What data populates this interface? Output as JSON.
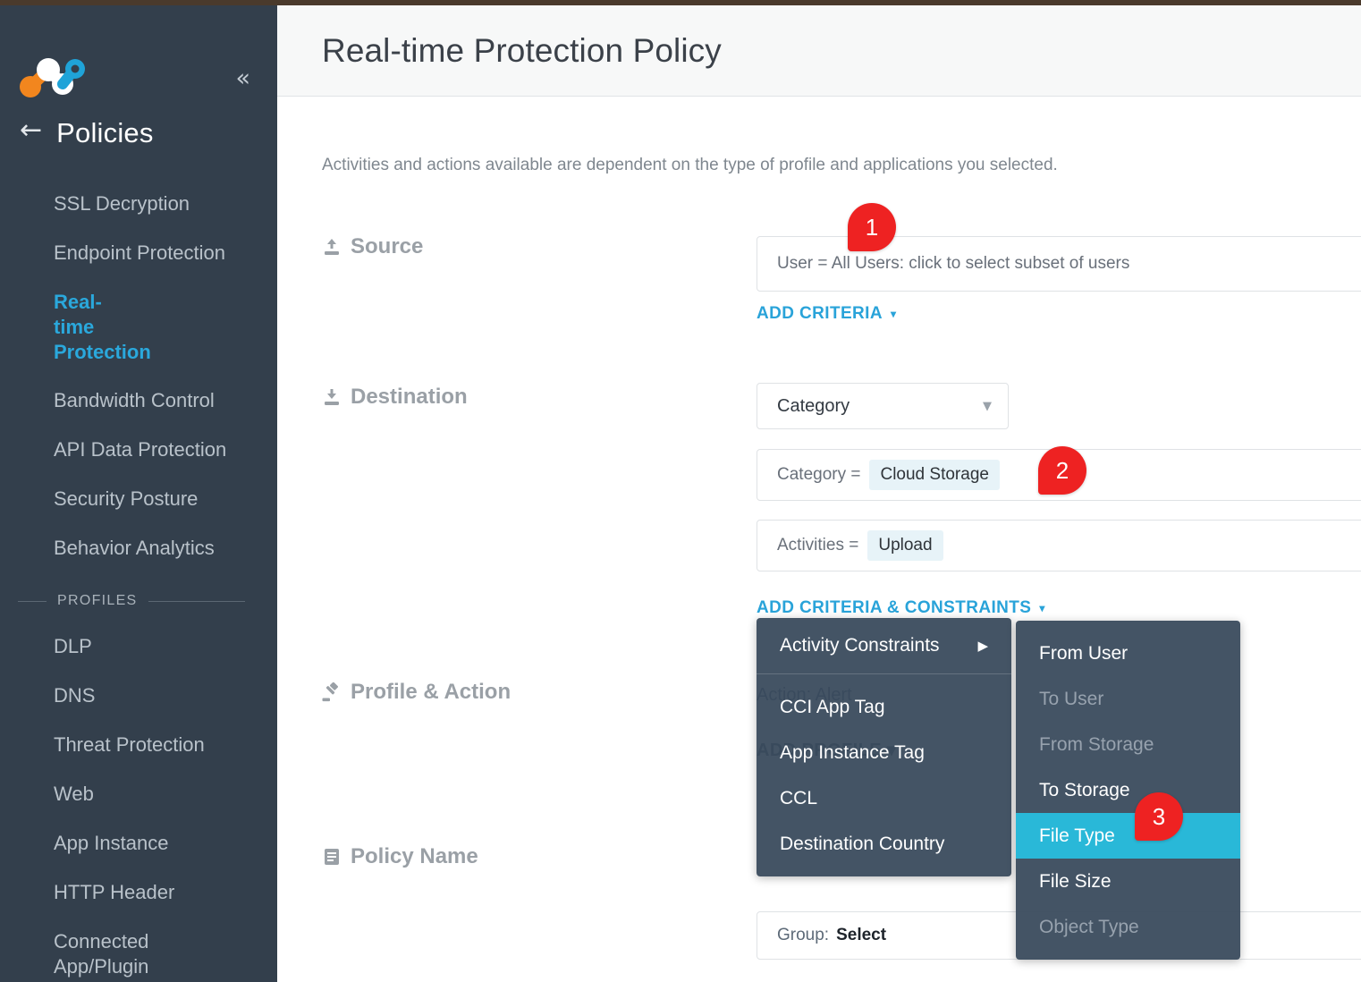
{
  "window": {
    "top_strip_color": "#4a3a2c"
  },
  "sidebar": {
    "collapse_icon": "double-chevron-left",
    "back_icon": "arrow-left",
    "header_title": "Policies",
    "items": [
      {
        "label": "SSL Decryption",
        "active": false
      },
      {
        "label": "Endpoint Protection",
        "active": false
      },
      {
        "label": "Real-time Protection",
        "active": true
      },
      {
        "label": "Bandwidth Control",
        "active": false
      },
      {
        "label": "API Data Protection",
        "active": false
      },
      {
        "label": "Security Posture",
        "active": false
      },
      {
        "label": "Behavior Analytics",
        "active": false
      }
    ],
    "section_divider_label": "PROFILES",
    "profile_items": [
      {
        "label": "DLP"
      },
      {
        "label": "DNS"
      },
      {
        "label": "Threat Protection"
      },
      {
        "label": "Web"
      },
      {
        "label": "App Instance"
      },
      {
        "label": "HTTP Header"
      },
      {
        "label": "Connected App/Plugin"
      }
    ]
  },
  "header": {
    "title": "Real-time Protection Policy"
  },
  "main": {
    "subtitle": "Activities and actions available are dependent on the type of profile and applications you selected.",
    "source": {
      "icon": "upload-icon",
      "label": "Source",
      "field_value": "User = All Users: click to select subset of users",
      "add_criteria_label": "ADD CRITERIA",
      "caret": "▾"
    },
    "destination": {
      "icon": "download-icon",
      "label": "Destination",
      "select_value": "Category",
      "criteria": [
        {
          "key": "Category =",
          "chip": "Cloud Storage"
        },
        {
          "key": "Activities =",
          "chip": "Upload"
        }
      ],
      "add_criteria_label": "ADD CRITERIA & CONSTRAINTS",
      "caret": "▾"
    },
    "profile_action": {
      "icon": "gavel-icon",
      "label": "Profile & Action",
      "ghost_action": "Action: Alert",
      "ghost_add_profile": "ADD PROFILE",
      "ghost_caret": "▾"
    },
    "policy_name": {
      "icon": "document-icon",
      "label": "Policy Name",
      "group_prefix": "Group:",
      "group_value": "Select"
    }
  },
  "menus": {
    "primary": {
      "items": [
        {
          "label": "Activity Constraints",
          "submenu_arrow": "▶",
          "has_submenu": true
        },
        {
          "label": "CCI App Tag",
          "has_submenu": false
        },
        {
          "label": "App Instance Tag",
          "has_submenu": false
        },
        {
          "label": "CCL",
          "has_submenu": false
        },
        {
          "label": "Destination Country",
          "has_submenu": false
        }
      ]
    },
    "submenu": {
      "items": [
        {
          "label": "From User",
          "state": "enabled"
        },
        {
          "label": "To User",
          "state": "disabled"
        },
        {
          "label": "From Storage",
          "state": "disabled"
        },
        {
          "label": "To Storage",
          "state": "enabled"
        },
        {
          "label": "File Type",
          "state": "highlighted"
        },
        {
          "label": "File Size",
          "state": "enabled"
        },
        {
          "label": "Object Type",
          "state": "disabled"
        }
      ]
    }
  },
  "badges": [
    {
      "number": "1"
    },
    {
      "number": "2"
    },
    {
      "number": "3"
    }
  ],
  "colors": {
    "accent_blue": "#29a3d9",
    "highlight_cyan": "#29b8d8",
    "badge_red": "#ee2222",
    "sidebar_bg": "#333f4c",
    "menu_bg": "#38495b"
  }
}
